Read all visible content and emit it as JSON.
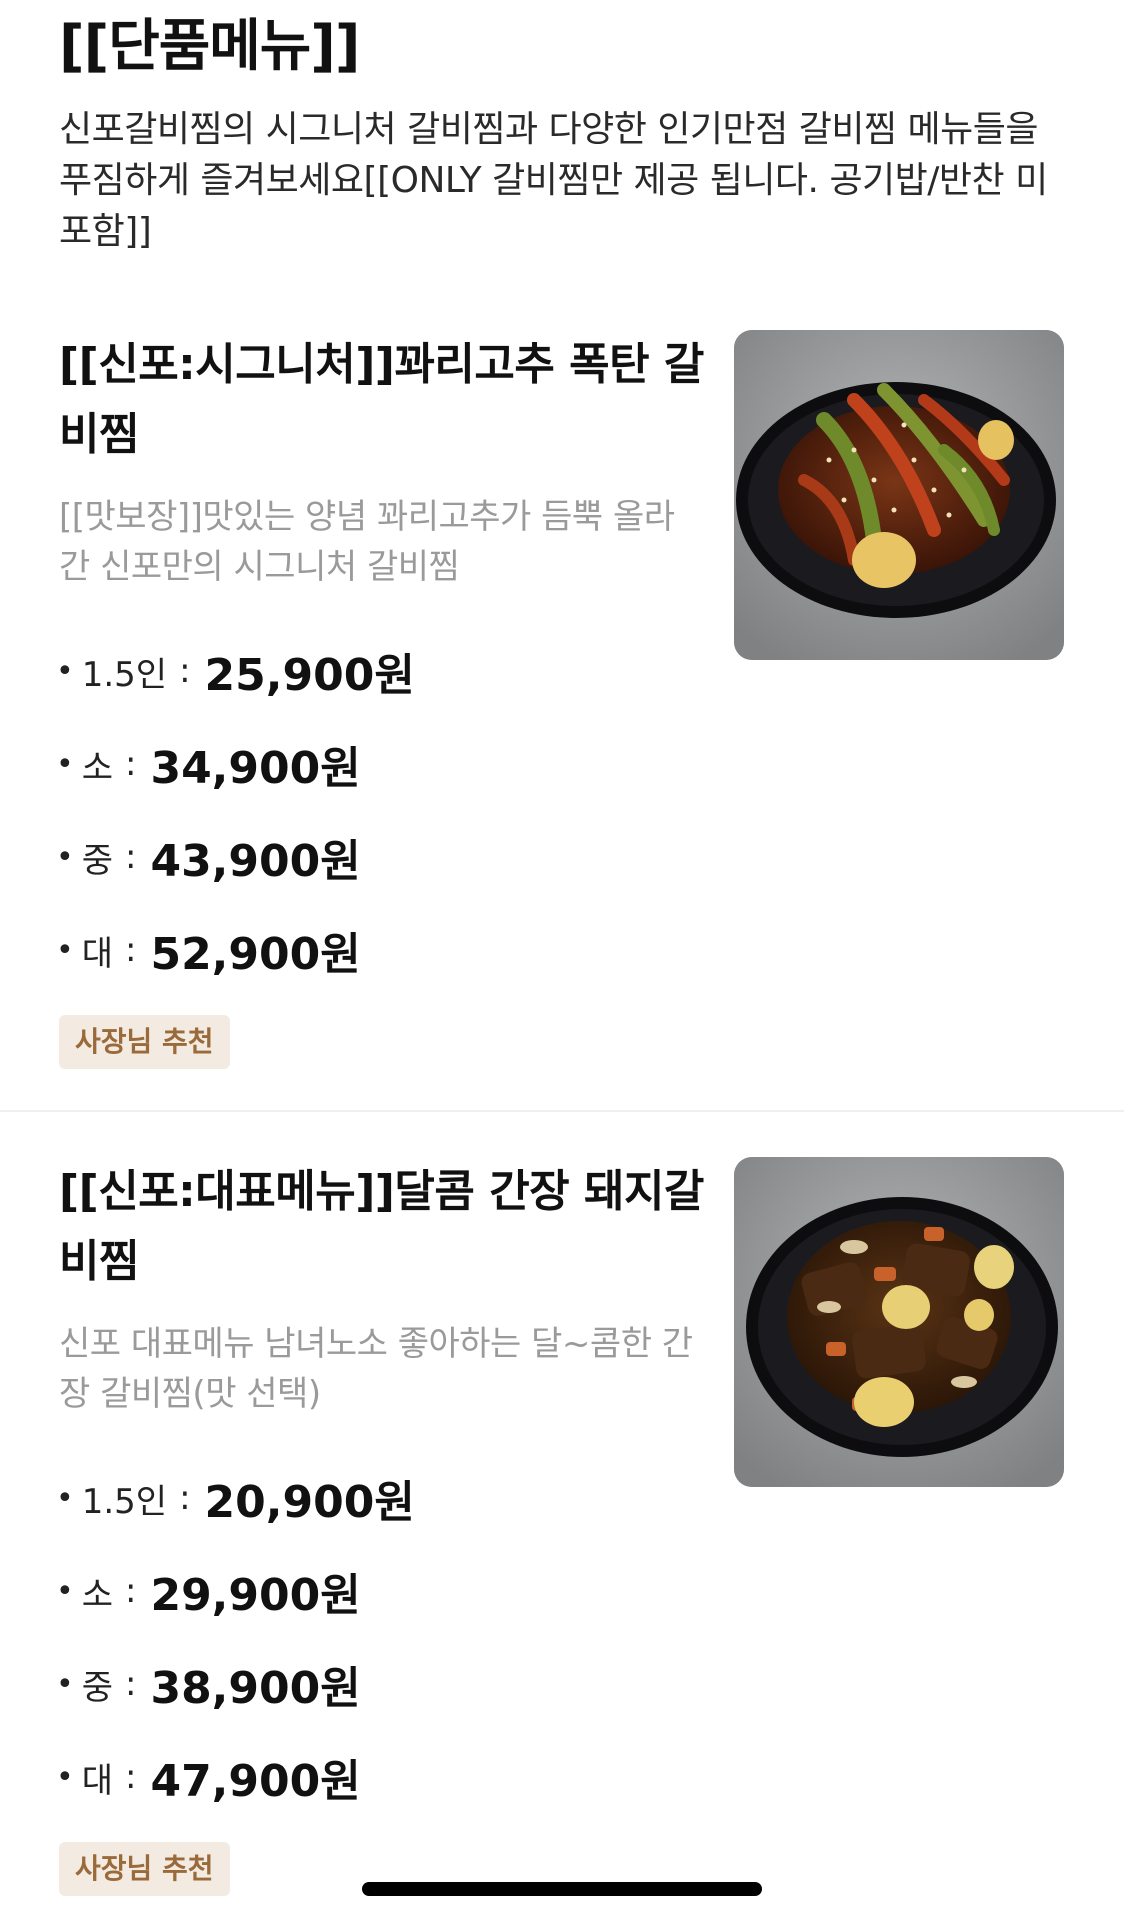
{
  "section": {
    "title": "[[단품메뉴]]",
    "description": "신포갈비찜의 시그니처 갈비찜과 다양한 인기만점 갈비찜 메뉴들을 푸짐하게 즐겨보세요[[ONLY 갈비찜만 제공 됩니다. 공기밥/반찬 미포함]]"
  },
  "items": [
    {
      "name": "[[신포:시그니처]]꽈리고추 폭탄 갈비찜",
      "description": "[[맛보장]]맛있는 양념 꽈리고추가 듬뿍 올라 간 신포만의 시그니처 갈비찜",
      "prices": [
        {
          "bullet": "•",
          "label": "1.5인",
          "colon": ":",
          "value": "25,900원"
        },
        {
          "bullet": "•",
          "label": "소",
          "colon": ":",
          "value": "34,900원"
        },
        {
          "bullet": "•",
          "label": "중",
          "colon": ":",
          "value": "43,900원"
        },
        {
          "bullet": "•",
          "label": "대",
          "colon": ":",
          "value": "52,900원"
        }
      ],
      "badge": "사장님 추천",
      "image_icon": "food-photo-spicy-galbi-jjim"
    },
    {
      "name": "[[신포:대표메뉴]]달콤 간장 돼지갈비찜",
      "description": "신포 대표메뉴 남녀노소 좋아하는 달~콤한 간장 갈비찜(맛 선택)",
      "prices": [
        {
          "bullet": "•",
          "label": "1.5인",
          "colon": ":",
          "value": "20,900원"
        },
        {
          "bullet": "•",
          "label": "소",
          "colon": ":",
          "value": "29,900원"
        },
        {
          "bullet": "•",
          "label": "중",
          "colon": ":",
          "value": "38,900원"
        },
        {
          "bullet": "•",
          "label": "대",
          "colon": ":",
          "value": "47,900원"
        }
      ],
      "badge": "사장님 추천",
      "image_icon": "food-photo-soy-galbi-jjim"
    }
  ],
  "colors": {
    "badge_background": "#f3ebe2",
    "badge_text": "#9a6a3a",
    "description_text": "#9a9a9a",
    "divider": "#efefef"
  }
}
